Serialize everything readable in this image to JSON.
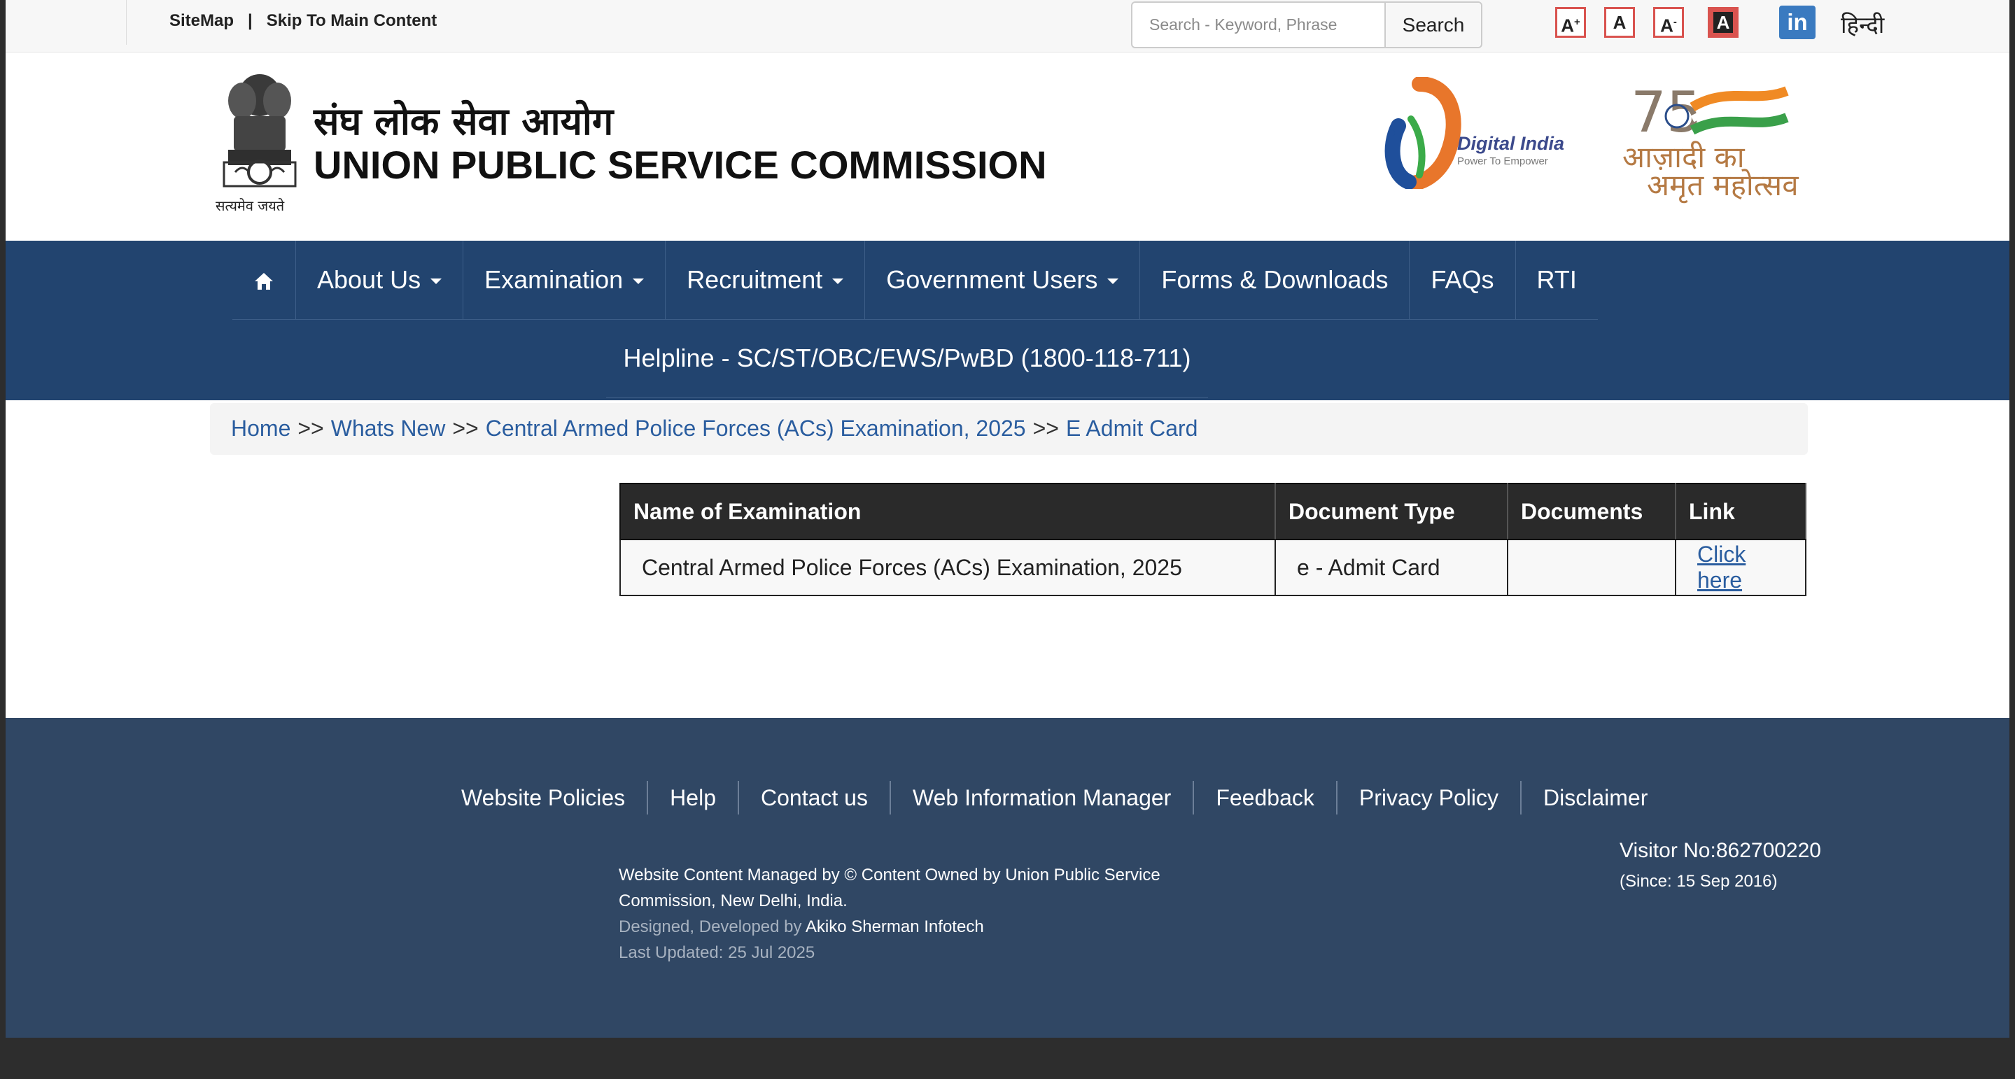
{
  "topbar": {
    "sitemap": "SiteMap",
    "separator": "|",
    "skip_link": "Skip To Main Content",
    "search_placeholder": "Search - Keyword, Phrase",
    "search_button": "Search",
    "font_increase": "A",
    "font_increase_sup": "+",
    "font_normal": "A",
    "font_decrease": "A",
    "font_decrease_sup": "-",
    "contrast": "A",
    "linkedin": "in",
    "hindi_link": "हिन्दी"
  },
  "header": {
    "emblem_caption": "सत्यमेव जयते",
    "title_hindi": "संघ लोक सेवा आयोग",
    "title_english": "UNION PUBLIC SERVICE COMMISSION",
    "digital_india": "Digital India",
    "digital_india_tagline": "Power To Empower",
    "azadi_line1": "आज़ादी का",
    "azadi_line2": "अमृत महोत्सव"
  },
  "nav": {
    "items": [
      {
        "label": "About Us",
        "dropdown": true
      },
      {
        "label": "Examination",
        "dropdown": true
      },
      {
        "label": "Recruitment",
        "dropdown": true
      },
      {
        "label": "Government Users",
        "dropdown": true
      },
      {
        "label": "Forms & Downloads",
        "dropdown": false
      },
      {
        "label": "FAQs",
        "dropdown": false
      },
      {
        "label": "RTI",
        "dropdown": false
      }
    ],
    "helpline": "Helpline - SC/ST/OBC/EWS/PwBD (1800-118-711)"
  },
  "breadcrumb": {
    "home": "Home",
    "whats_new": "Whats New",
    "exam": "Central Armed Police Forces (ACs) Examination, 2025",
    "current": "E Admit Card",
    "sep": ">>"
  },
  "table": {
    "headers": [
      "Name of Examination",
      "Document Type",
      "Documents",
      "Link"
    ],
    "rows": [
      {
        "exam": "Central Armed Police Forces (ACs) Examination, 2025",
        "doc_type": "e - Admit Card",
        "documents": "",
        "link": "Click here"
      }
    ]
  },
  "footer": {
    "links": [
      "Website Policies",
      "Help",
      "Contact us",
      "Web Information Manager",
      "Feedback",
      "Privacy Policy",
      "Disclaimer"
    ],
    "managed_by": "Website Content Managed by © Content Owned by Union Public Service Commission, New Delhi, India.",
    "designed_prefix": "Designed, Developed by",
    "designed_by": "Akiko Sherman Infotech",
    "last_updated": "Last Updated: 25 Jul 2025",
    "visitor_label": "Visitor No:862700220",
    "visitor_since": "(Since: 15 Sep 2016)"
  },
  "colors": {
    "nav_bg": "#22446f",
    "footer_bg": "#304764",
    "link": "#2a5d9f",
    "table_header": "#2a2a2a"
  }
}
